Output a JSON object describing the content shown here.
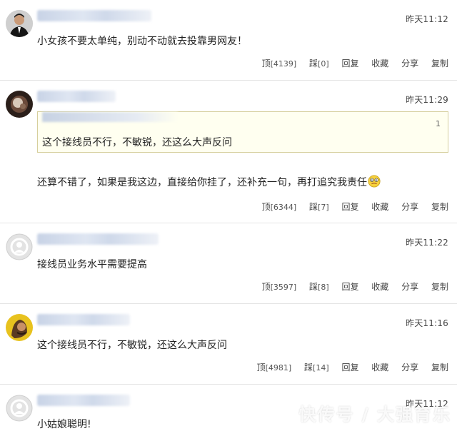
{
  "actions": {
    "ding": "顶",
    "cai": "踩",
    "reply": "回复",
    "favorite": "收藏",
    "share": "分享",
    "copy": "复制"
  },
  "comments": [
    {
      "time": "昨天11:12",
      "text": "小女孩不要太单纯，别动不动就去投靠男网友！",
      "up": "[4139]",
      "down": "[0]",
      "avatar_icon": "man-in-suit-avatar"
    },
    {
      "time": "昨天11:29",
      "quote": {
        "floor": "1",
        "text": "这个接线员不行，不敏锐，还这么大声反问"
      },
      "text": "还算不错了，如果是我这边，直接给你挂了，还补充一句，再打追究我责任",
      "emoji_icon": "dizzy-face-emoji",
      "up": "[6344]",
      "down": "[7]",
      "avatar_icon": "dark-photo-avatar"
    },
    {
      "time": "昨天11:22",
      "text": "接线员业务水平需要提高",
      "up": "[3597]",
      "down": "[8]",
      "avatar_icon": "default-user-avatar"
    },
    {
      "time": "昨天11:16",
      "text": "这个接线员不行，不敏锐，还这么大声反问",
      "up": "[4981]",
      "down": "[14]",
      "avatar_icon": "cartoon-character-avatar"
    },
    {
      "time": "昨天11:12",
      "text": "小姑娘聪明!",
      "avatar_icon": "default-user-avatar"
    }
  ],
  "watermark": "快传号 / 大强育乐"
}
